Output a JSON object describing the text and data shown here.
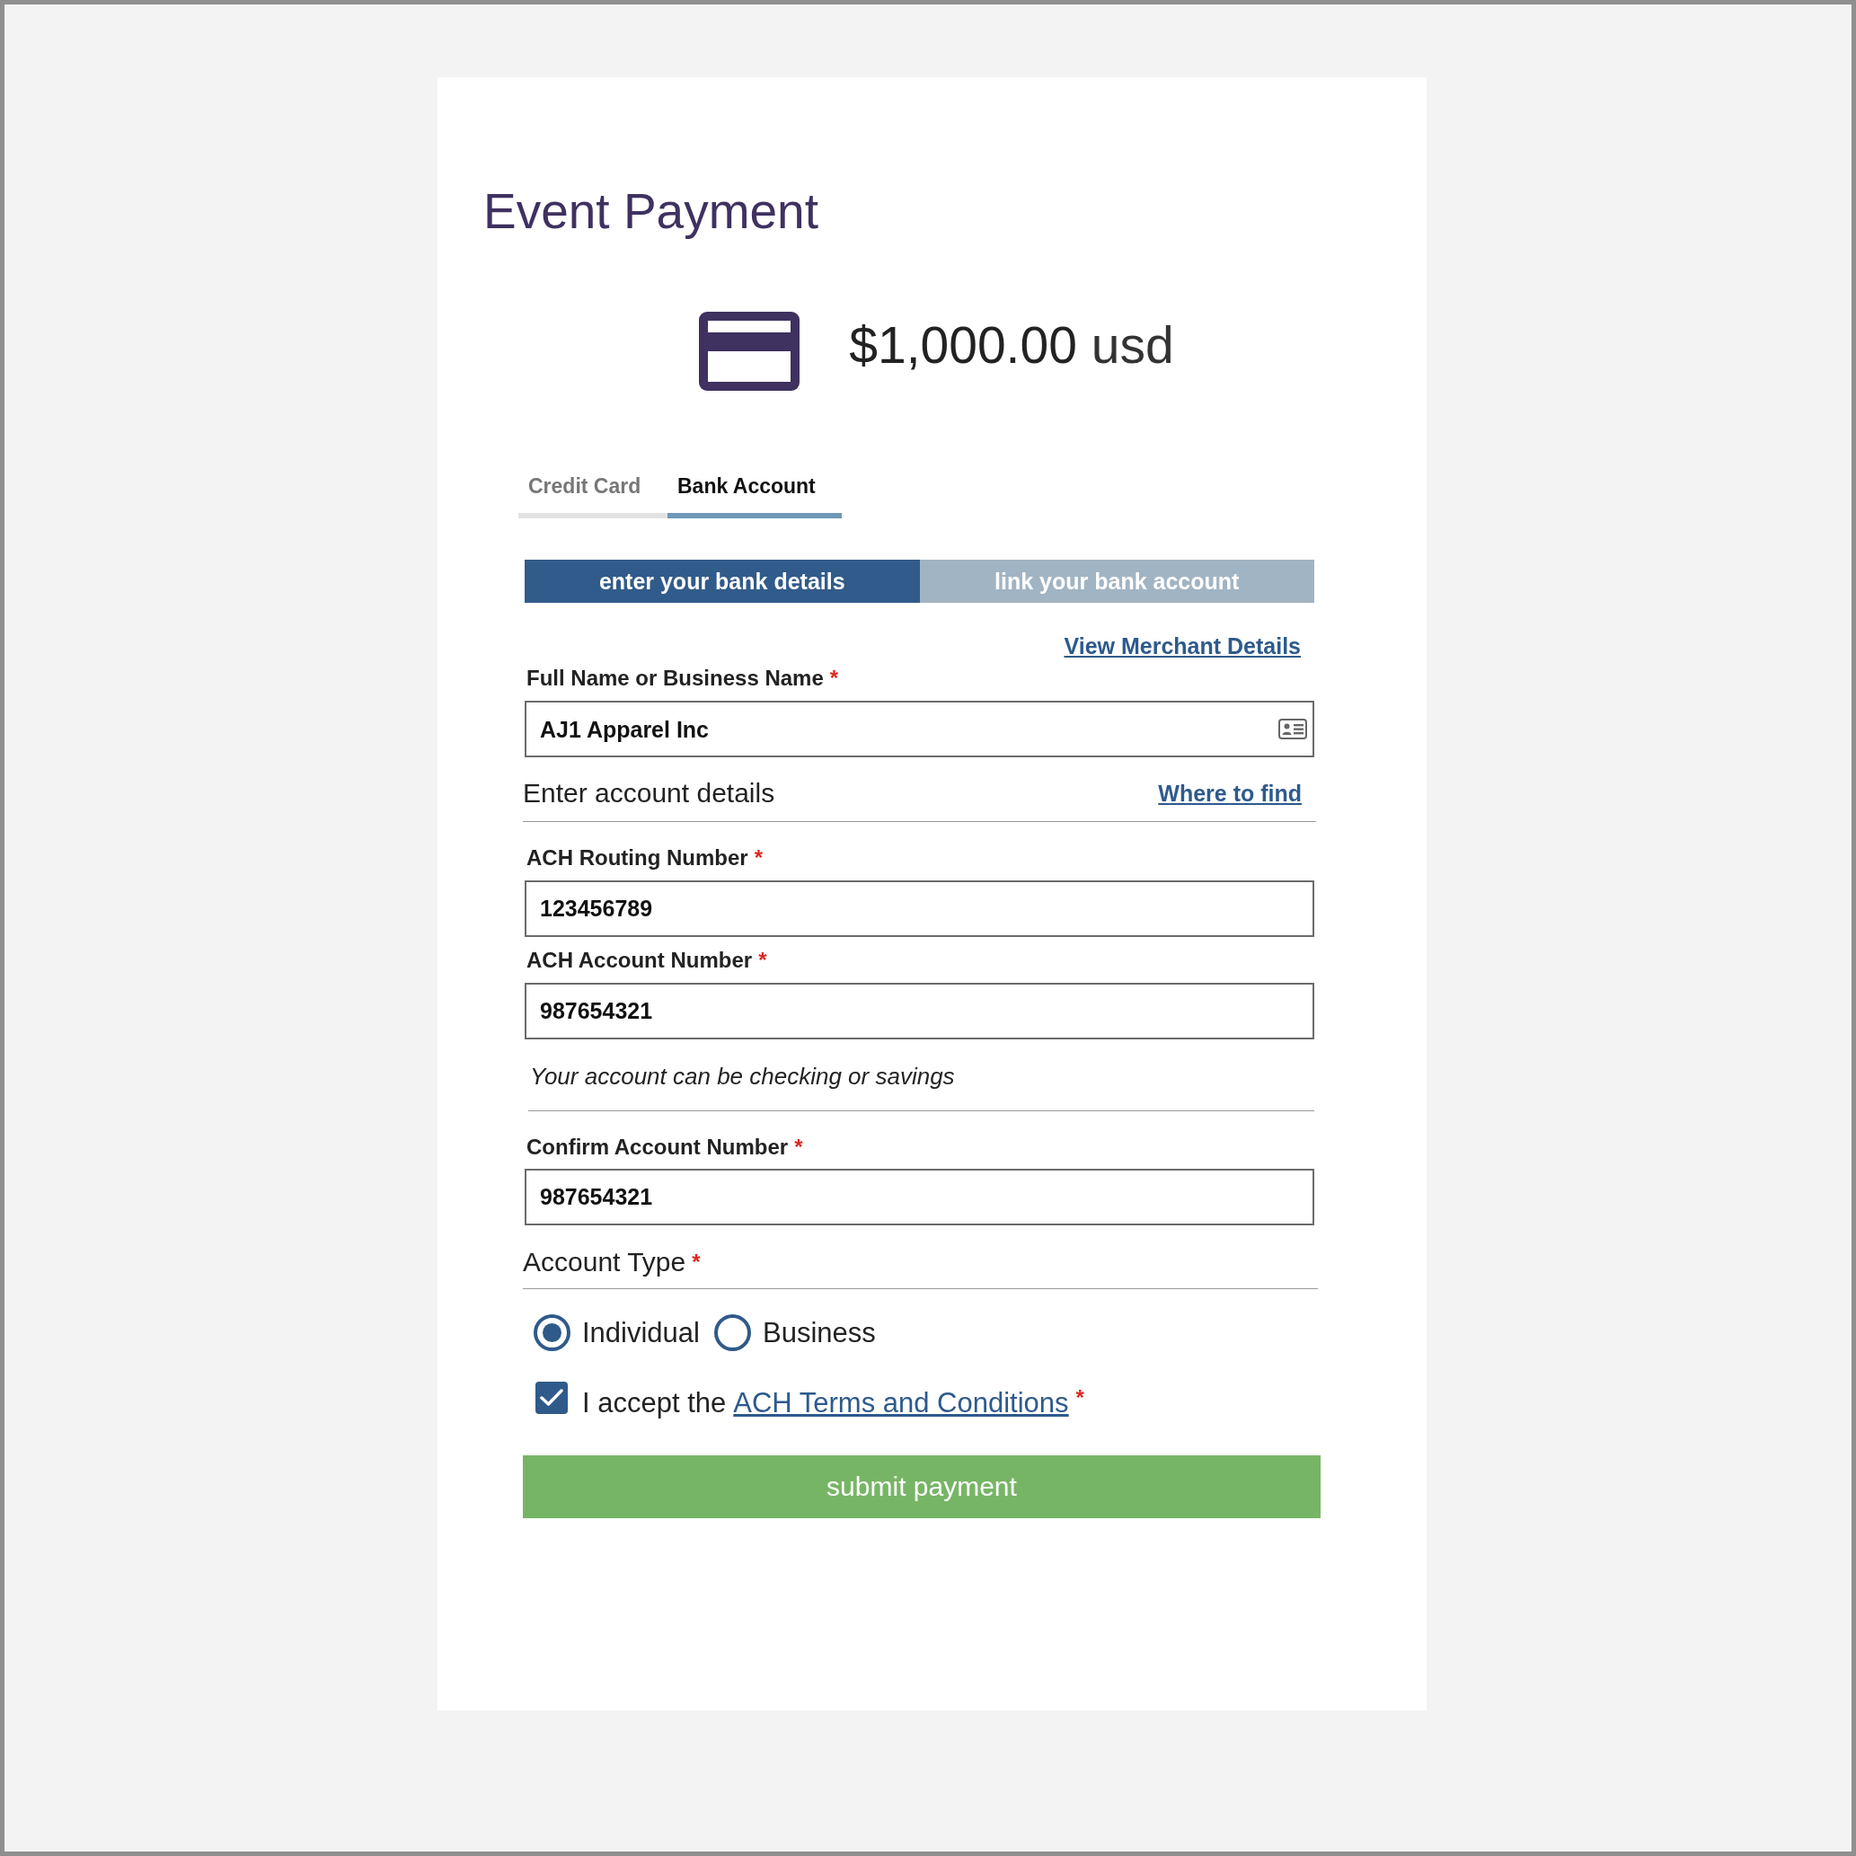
{
  "page": {
    "title": "Event Payment"
  },
  "amount": {
    "value": "$1,000.00",
    "currency": "usd"
  },
  "payment_tabs": [
    {
      "label": "Credit Card",
      "selected": false
    },
    {
      "label": "Bank Account",
      "selected": true
    }
  ],
  "entry_modes": [
    {
      "label": "enter your bank details",
      "selected": true
    },
    {
      "label": "link your bank account",
      "selected": false
    }
  ],
  "merchant_link": "View Merchant Details",
  "name_field": {
    "label": "Full Name or Business Name",
    "required_mark": "*",
    "value": "AJ1 Apparel Inc"
  },
  "account_section": {
    "title": "Enter account details",
    "link": "Where to find"
  },
  "account_fields": [
    {
      "label": "ACH Routing Number",
      "required_mark": "*",
      "value": "123456789"
    },
    {
      "label": "ACH Account Number",
      "required_mark": "*",
      "value": "987654321"
    }
  ],
  "account_hint": "Your account can be checking or savings",
  "confirm_field": {
    "label": "Confirm Account Number",
    "required_mark": "*",
    "value": "987654321"
  },
  "account_type": {
    "title": "Account Type",
    "required_mark": "*",
    "options": [
      {
        "label": "Individual",
        "selected": true
      },
      {
        "label": "Business",
        "selected": false
      }
    ]
  },
  "terms": {
    "checked": true,
    "prefix": "I accept the",
    "link": "ACH Terms and Conditions",
    "required_mark": "*"
  },
  "submit": "submit payment"
}
